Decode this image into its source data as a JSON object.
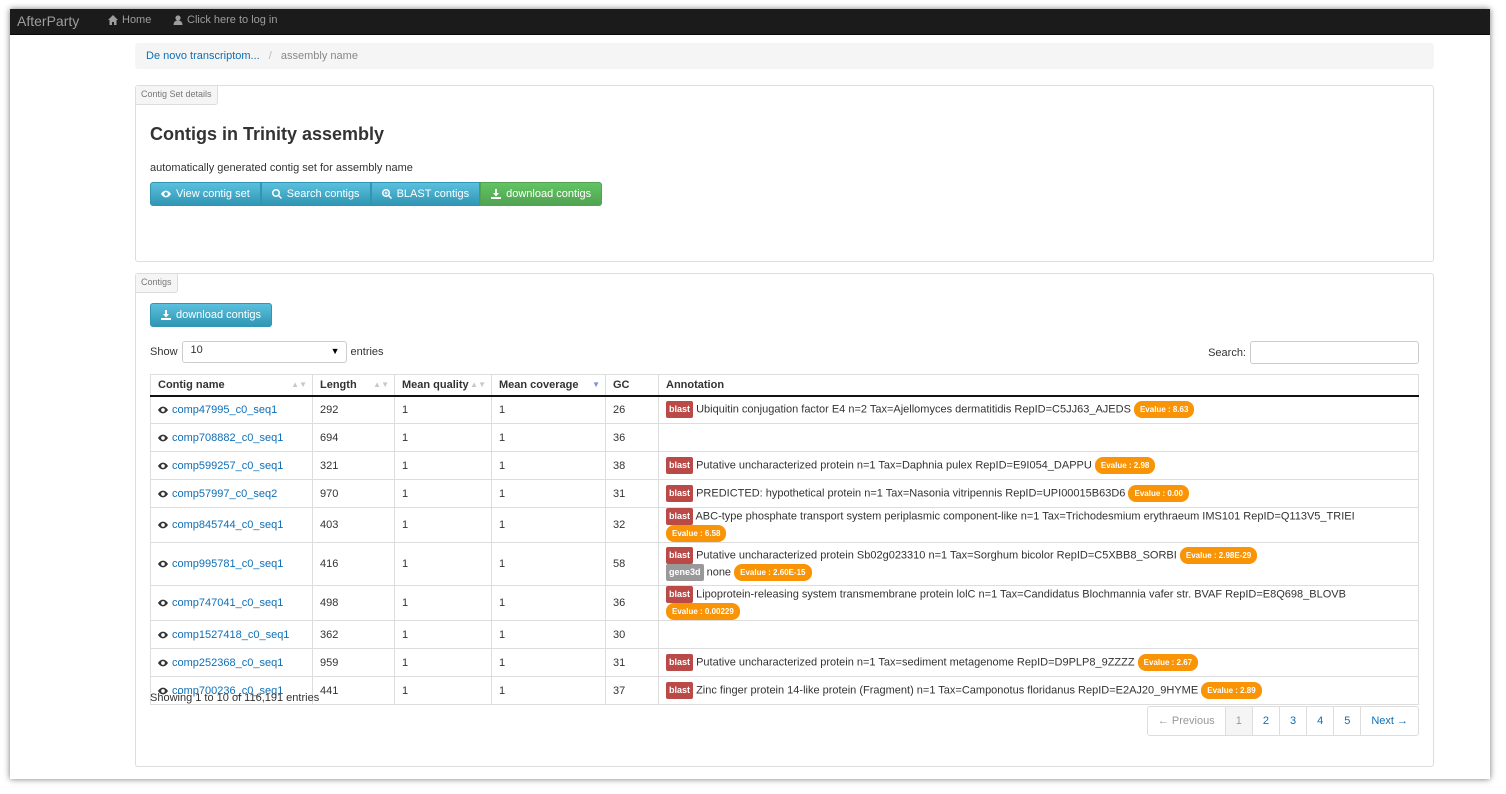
{
  "navbar": {
    "brand": "AfterParty",
    "home_label": "Home",
    "login_label": "Click here to log in"
  },
  "breadcrumb": {
    "parent": "De novo transcriptom...",
    "current": "assembly name"
  },
  "details_panel": {
    "tab": "Contig Set details",
    "title": "Contigs in Trinity assembly",
    "subtitle": "automatically generated contig set for assembly name",
    "buttons": {
      "view": "View contig set",
      "search": "Search contigs",
      "blast": "BLAST contigs",
      "download": "download contigs"
    }
  },
  "contigs_panel": {
    "tab": "Contigs",
    "download_button": "download contigs",
    "show_label": "Show",
    "entries_value": "10",
    "entries_label": "entries",
    "search_label": "Search:",
    "search_value": "",
    "columns": [
      "Contig name",
      "Length",
      "Mean quality",
      "Mean coverage",
      "GC",
      "Annotation"
    ],
    "rows": [
      {
        "name": "comp47995_c0_seq1",
        "length": "292",
        "quality": "1",
        "coverage": "1",
        "gc": "26",
        "annotations": [
          {
            "label": "blast",
            "text": "Ubiquitin conjugation factor E4 n=2 Tax=Ajellomyces dermatitidis RepID=C5JJ63_AJEDS",
            "evalue": "Evalue : 8.63"
          }
        ]
      },
      {
        "name": "comp708882_c0_seq1",
        "length": "694",
        "quality": "1",
        "coverage": "1",
        "gc": "36",
        "annotations": []
      },
      {
        "name": "comp599257_c0_seq1",
        "length": "321",
        "quality": "1",
        "coverage": "1",
        "gc": "38",
        "annotations": [
          {
            "label": "blast",
            "text": "Putative uncharacterized protein n=1 Tax=Daphnia pulex RepID=E9I054_DAPPU",
            "evalue": "Evalue : 2.98"
          }
        ]
      },
      {
        "name": "comp57997_c0_seq2",
        "length": "970",
        "quality": "1",
        "coverage": "1",
        "gc": "31",
        "annotations": [
          {
            "label": "blast",
            "text": "PREDICTED: hypothetical protein n=1 Tax=Nasonia vitripennis RepID=UPI00015B63D6",
            "evalue": "Evalue : 0.00"
          }
        ]
      },
      {
        "name": "comp845744_c0_seq1",
        "length": "403",
        "quality": "1",
        "coverage": "1",
        "gc": "32",
        "annotations": [
          {
            "label": "blast",
            "text": "ABC-type phosphate transport system periplasmic component-like n=1 Tax=Trichodesmium erythraeum IMS101 RepID=Q113V5_TRIEI",
            "evalue": "Evalue : 6.58"
          }
        ]
      },
      {
        "name": "comp995781_c0_seq1",
        "length": "416",
        "quality": "1",
        "coverage": "1",
        "gc": "58",
        "annotations": [
          {
            "label": "blast",
            "text": "Putative uncharacterized protein Sb02g023310 n=1 Tax=Sorghum bicolor RepID=C5XBB8_SORBI",
            "evalue": "Evalue : 2.98E-29"
          },
          {
            "label": "gene3d",
            "text": "none",
            "evalue": "Evalue : 2.60E-15"
          }
        ]
      },
      {
        "name": "comp747041_c0_seq1",
        "length": "498",
        "quality": "1",
        "coverage": "1",
        "gc": "36",
        "annotations": [
          {
            "label": "blast",
            "text": "Lipoprotein-releasing system transmembrane protein lolC n=1 Tax=Candidatus Blochmannia vafer str. BVAF RepID=E8Q698_BLOVB",
            "evalue": "Evalue : 0.00229"
          }
        ]
      },
      {
        "name": "comp1527418_c0_seq1",
        "length": "362",
        "quality": "1",
        "coverage": "1",
        "gc": "30",
        "annotations": []
      },
      {
        "name": "comp252368_c0_seq1",
        "length": "959",
        "quality": "1",
        "coverage": "1",
        "gc": "31",
        "annotations": [
          {
            "label": "blast",
            "text": "Putative uncharacterized protein n=1 Tax=sediment metagenome RepID=D9PLP8_9ZZZZ",
            "evalue": "Evalue : 2.67"
          }
        ]
      },
      {
        "name": "comp700236_c0_seq1",
        "length": "441",
        "quality": "1",
        "coverage": "1",
        "gc": "37",
        "annotations": [
          {
            "label": "blast",
            "text": "Zinc finger protein 14-like protein (Fragment) n=1 Tax=Camponotus floridanus RepID=E2AJ20_9HYME",
            "evalue": "Evalue : 2.89"
          }
        ]
      }
    ],
    "info": "Showing 1 to 10 of 116,191 entries",
    "pagination": {
      "previous": "← Previous",
      "pages": [
        "1",
        "2",
        "3",
        "4",
        "5"
      ],
      "next": "Next →"
    }
  }
}
